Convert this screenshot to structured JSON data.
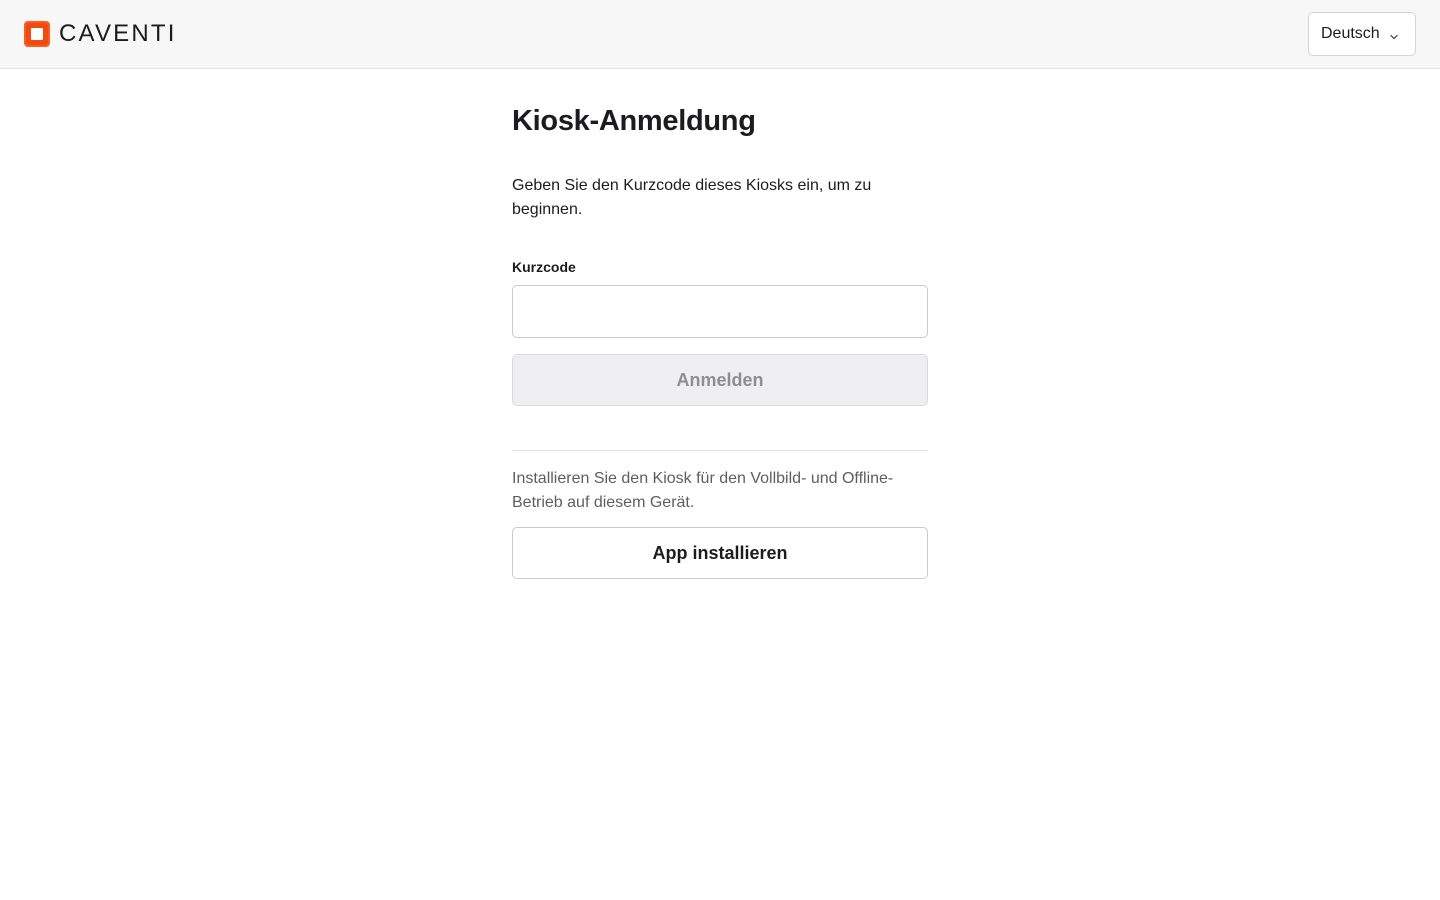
{
  "header": {
    "brand_name": "CAVENTI",
    "logo_icon": "caventi-logo-icon",
    "brand_color": "#ff5a1f",
    "language": {
      "selected": "Deutsch",
      "icon": "chevron-down-icon"
    }
  },
  "main": {
    "title": "Kiosk-Anmeldung",
    "intro": "Geben Sie den Kurzcode dieses Kiosks ein, um zu beginnen.",
    "code_field": {
      "label": "Kurzcode",
      "value": "",
      "placeholder": ""
    },
    "login_button": "Anmelden",
    "install_text": "Installieren Sie den Kiosk für den Vollbild- und Offline-Betrieb auf diesem Gerät.",
    "install_button": "App installieren"
  }
}
